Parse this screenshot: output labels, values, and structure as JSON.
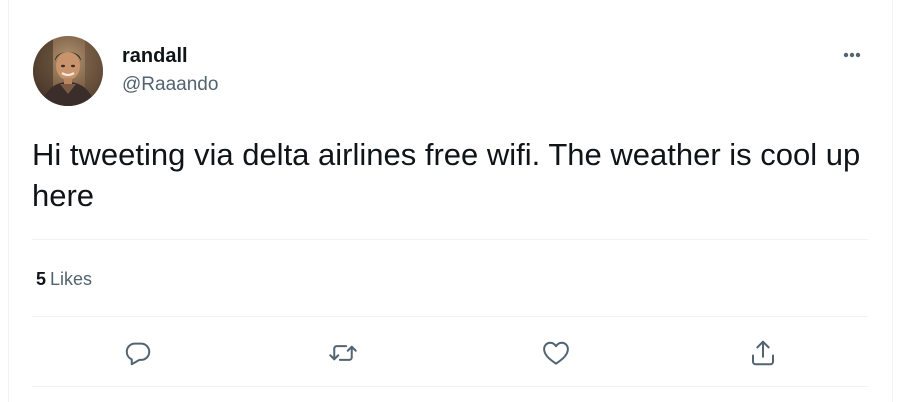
{
  "tweet": {
    "author": {
      "display_name": "randall",
      "handle": "@Raaando",
      "avatar": "profile-photo"
    },
    "more_icon": "more-horizontal-icon",
    "text": "Hi tweeting via delta airlines free wifi. The weather is cool up here",
    "likes": {
      "count": "5",
      "label": "Likes"
    },
    "actions": [
      {
        "name": "reply",
        "icon": "reply-icon"
      },
      {
        "name": "retweet",
        "icon": "retweet-icon"
      },
      {
        "name": "like",
        "icon": "heart-icon"
      },
      {
        "name": "share",
        "icon": "share-icon"
      }
    ]
  },
  "colors": {
    "text_primary": "#0f1419",
    "text_secondary": "#536471",
    "divider": "#eff3f4",
    "icon": "#536471"
  }
}
